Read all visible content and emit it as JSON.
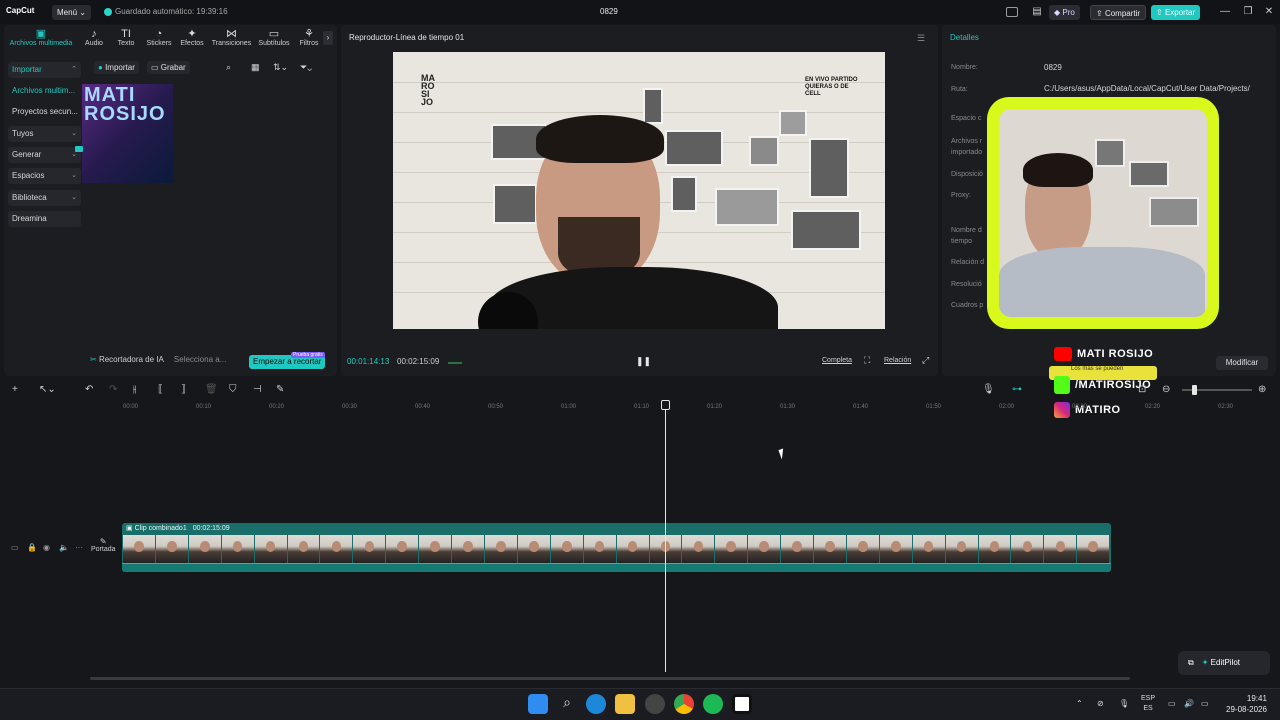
{
  "titlebar": {
    "app": "CapCut",
    "menu": "Menú",
    "autosave": "Guardado automático: 19:39:16",
    "project_title": "0829",
    "pro": "Pro",
    "share": "Compartir",
    "export": "Exportar"
  },
  "tools": {
    "tabs": [
      "Archivos multimedia",
      "Audio",
      "Texto",
      "Stickers",
      "Efectos",
      "Transiciones",
      "Subtítulos",
      "Filtros"
    ],
    "icons": [
      "▣",
      "♪",
      "TI",
      "◔",
      "✦",
      "⋈",
      "▭",
      "⚘"
    ]
  },
  "sidebar": {
    "import": "Importar",
    "items": [
      "Archivos multim...",
      "Proyectos secun...",
      "Tuyos",
      "Generar",
      "Espacios",
      "Biblioteca",
      "Dreamina"
    ]
  },
  "media": {
    "import_btn": "Importar",
    "record_btn": "Grabar",
    "thumb_text": "MATI ROSIJO"
  },
  "ai_recorder": {
    "label": "Recortadora de IA",
    "select": "Selecciona a...",
    "start": "Empezar a recortar",
    "badge": "Prueba gratis"
  },
  "player": {
    "title": "Reproductor-Línea de tiempo 01",
    "current_time": "00:01:14:13",
    "total_time": "00:02:15:09",
    "full": "Completa",
    "ratio": "Relación",
    "wall_sign": "EN VIVO PARTIDO QUIERAS O DE CELL"
  },
  "details": {
    "title": "Detalles",
    "labels": [
      "Nombre:",
      "Ruta:",
      "Espacio c",
      "Archivos r importado",
      "Disposició",
      "Proxy:",
      "Nombre d tiempo",
      "Relación d",
      "Resolució",
      "Cuadros p"
    ],
    "name_value": "0829",
    "path_value": "C:/Users/asus/AppData/Local/CapCut/User Data/Projects/",
    "modify": "Modificar"
  },
  "overlay": {
    "youtube": "MATI ROSIJO",
    "kick": "/MATIROSIJO",
    "instagram": "MATIRO",
    "kick_note": "Los mas se pueden"
  },
  "timeline": {
    "ticks": [
      "00:00",
      "00:10",
      "00:20",
      "00:30",
      "00:40",
      "00:50",
      "01:00",
      "01:10",
      "01:20",
      "01:30",
      "01:40",
      "01:50",
      "02:00",
      "02:10",
      "02:20",
      "02:30"
    ],
    "clip_name": "Clip combinado1",
    "clip_duration": "00:02:15:09",
    "cover": "Portada",
    "editpilot": "EditPilot"
  },
  "taskbar": {
    "lang_top": "ESP",
    "lang_bottom": "ES",
    "time": "19:41",
    "date": "29-08-2026"
  }
}
